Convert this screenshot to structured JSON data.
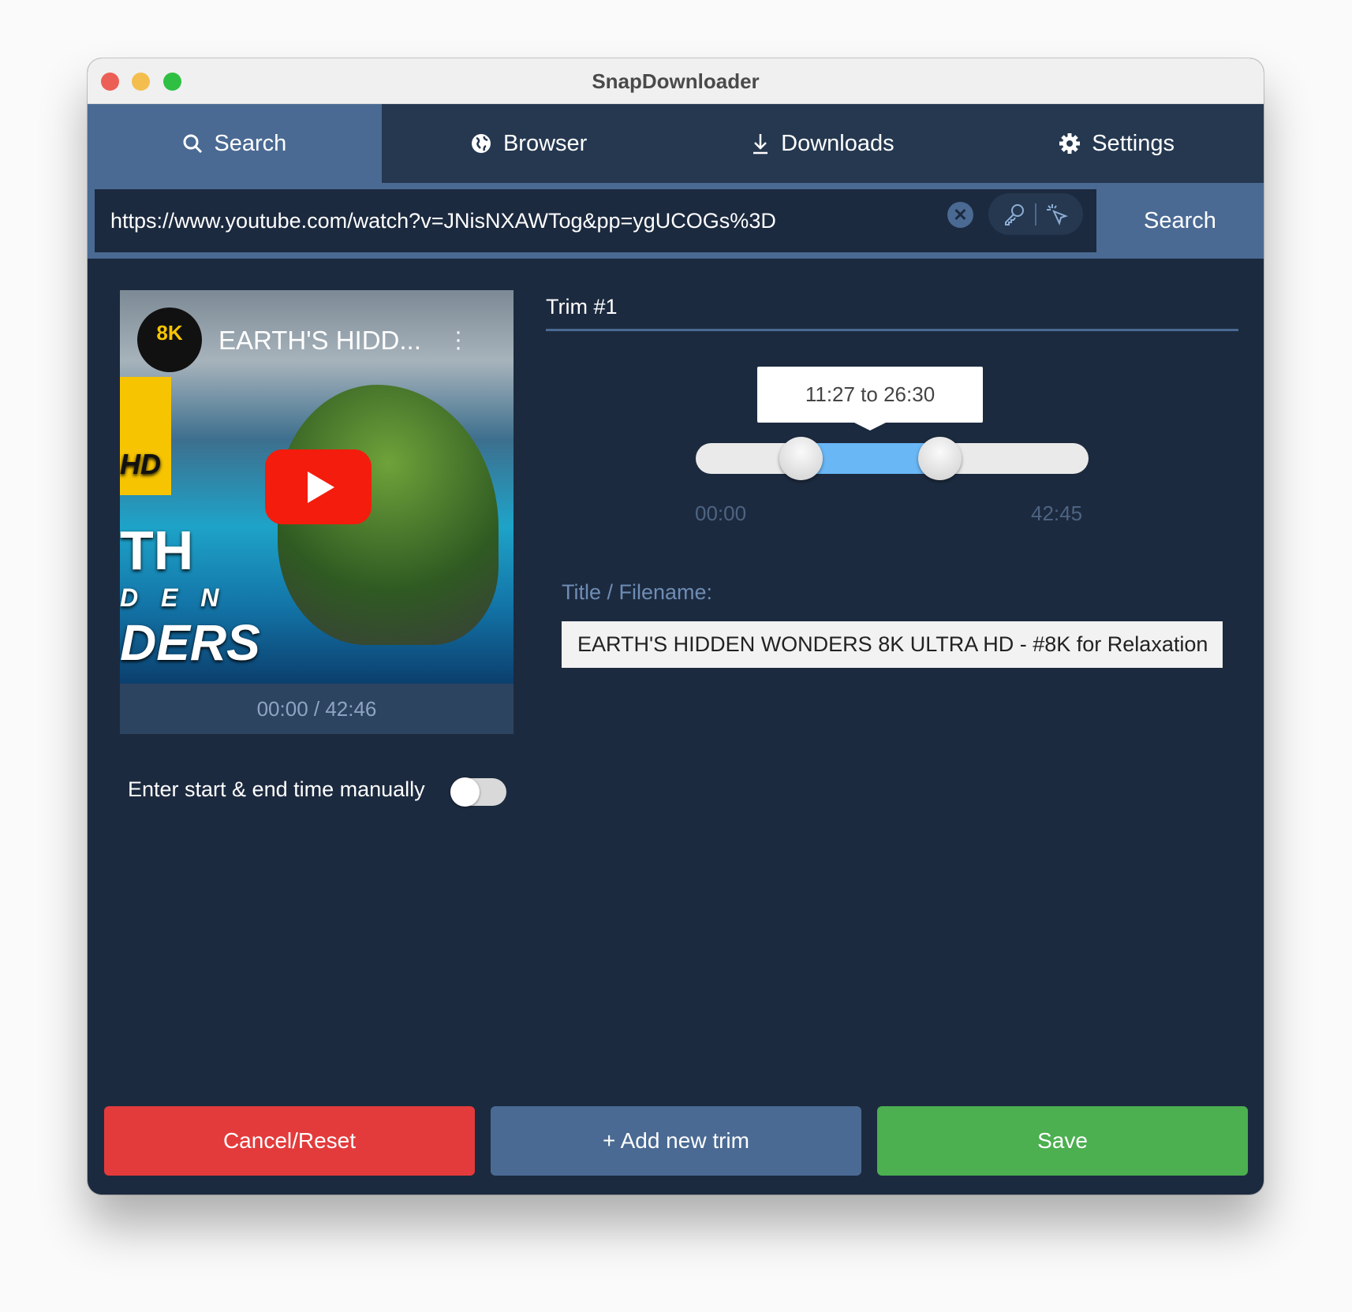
{
  "window": {
    "title": "SnapDownloader",
    "controls": {
      "close": "#ec5f57",
      "minimize": "#f4be4f",
      "maximize": "#2fc043"
    }
  },
  "tabs": [
    {
      "label": "Search",
      "icon": "search-icon"
    },
    {
      "label": "Browser",
      "icon": "globe-icon"
    },
    {
      "label": "Downloads",
      "icon": "download-icon"
    },
    {
      "label": "Settings",
      "icon": "gear-icon"
    }
  ],
  "url_bar": {
    "value": "https://www.youtube.com/watch?v=JNisNXAWTog&pp=ygUCOGs%3D",
    "search_label": "Search"
  },
  "video": {
    "badge": "8K",
    "title": "EARTH'S HIDD...",
    "overlay_text": [
      "HD",
      "TH",
      "D E N",
      "DERS"
    ],
    "time": "00:00 / 42:46"
  },
  "trim": {
    "tab_label": "Trim #1",
    "range_label": "11:27  to  26:30",
    "start_label": "00:00",
    "end_label": "42:45",
    "start_value": "11:27",
    "end_value": "26:30",
    "duration": "42:45",
    "start_fraction": 0.268,
    "end_fraction": 0.62
  },
  "filename": {
    "label": "Title / Filename:",
    "value": "EARTH'S HIDDEN WONDERS 8K ULTRA HD - #8K for Relaxation"
  },
  "manual": {
    "label": "Enter start & end time manually",
    "enabled": false
  },
  "buttons": {
    "cancel": "Cancel/Reset",
    "add": "+ Add new trim",
    "save": "Save"
  },
  "colors": {
    "cancel": "#e33b3b",
    "add": "#4a6a93",
    "save": "#4caf50",
    "range": "#6ab7f5",
    "background": "#1c2a3f"
  }
}
